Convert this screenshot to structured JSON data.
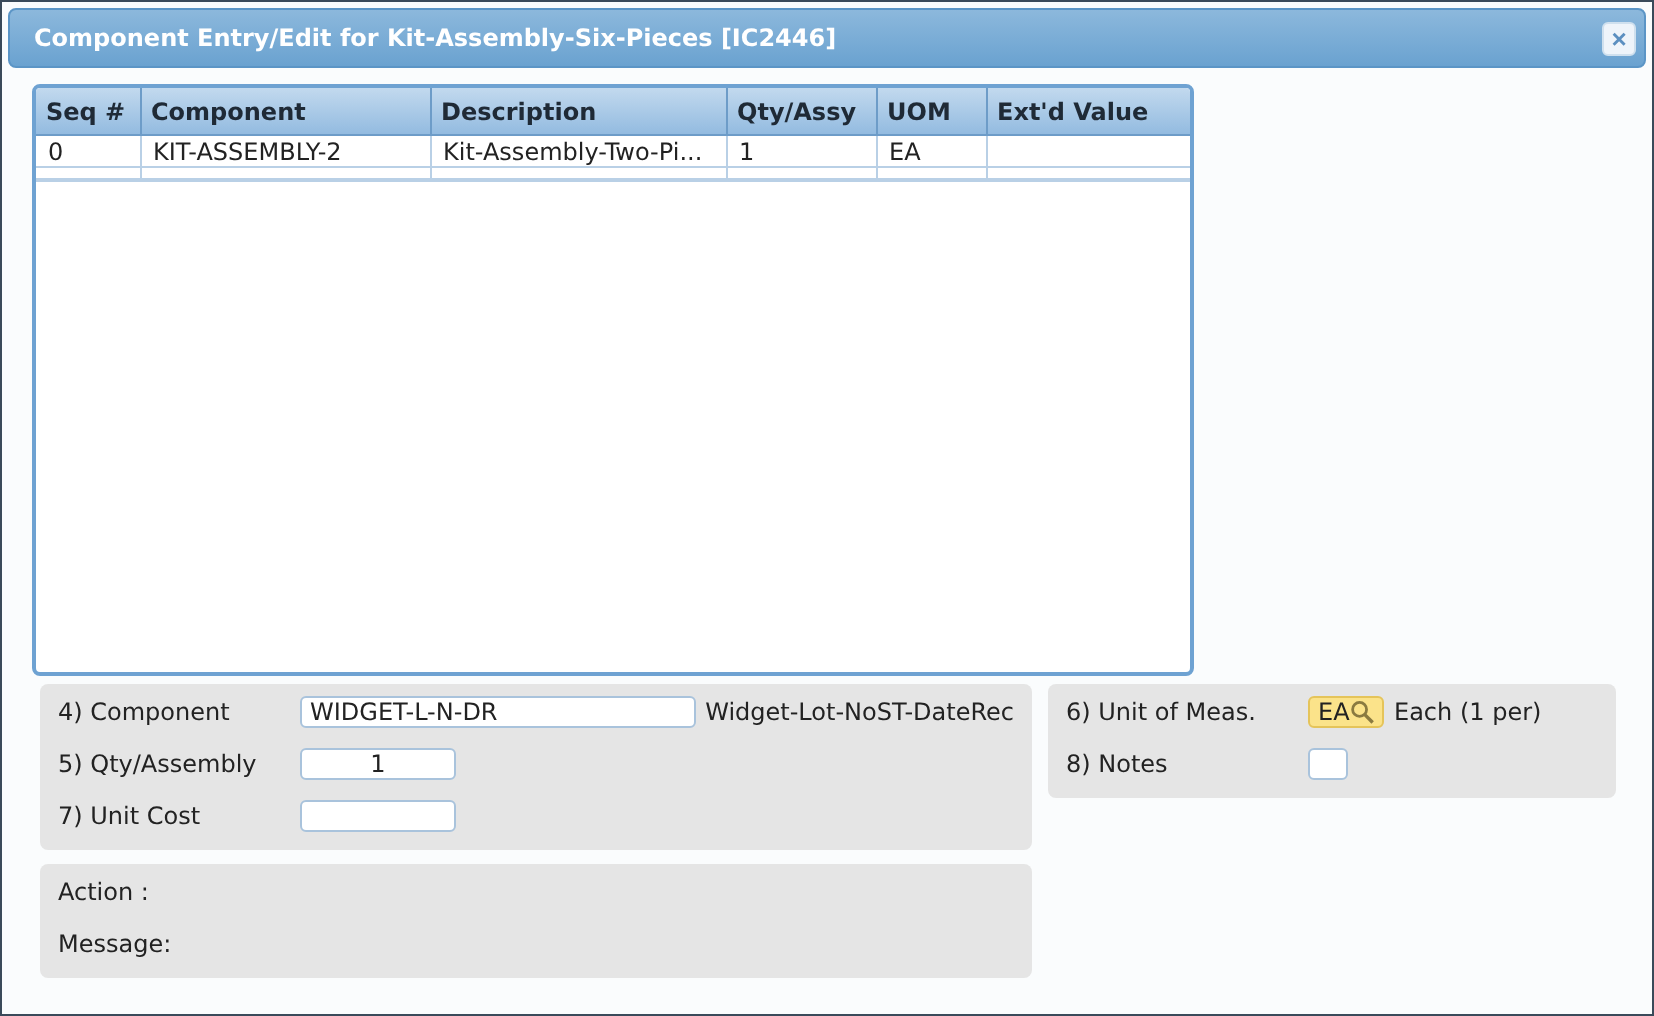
{
  "window": {
    "title": "Component Entry/Edit for Kit-Assembly-Six-Pieces [IC2446]",
    "close": "×"
  },
  "table": {
    "columns": [
      "Seq #",
      "Component",
      "Description",
      "Qty/Assy",
      "UOM",
      "Ext'd Value"
    ],
    "rows": [
      [
        "0",
        "KIT-ASSEMBLY-2",
        "Kit-Assembly-Two-Pi...",
        "1",
        "EA",
        null
      ]
    ]
  },
  "form": {
    "fields": [
      {
        "label": "4) Component",
        "value": "WIDGET-L-N-DR",
        "kind": "wide",
        "description": "Widget-Lot-NoST-DateRec"
      },
      {
        "label": "5) Qty/Assembly",
        "value": "1",
        "kind": "number"
      },
      {
        "label": "7) Unit Cost",
        "kind": "number"
      }
    ]
  },
  "side": {
    "fields": [
      {
        "label": "6) Unit of Meas.",
        "value": "EA",
        "kind": "lookup",
        "description": "Each (1 per)"
      },
      {
        "label": "8) Notes",
        "kind": "small"
      }
    ]
  },
  "status": {
    "lines": [
      "Action :",
      "Message:"
    ]
  }
}
